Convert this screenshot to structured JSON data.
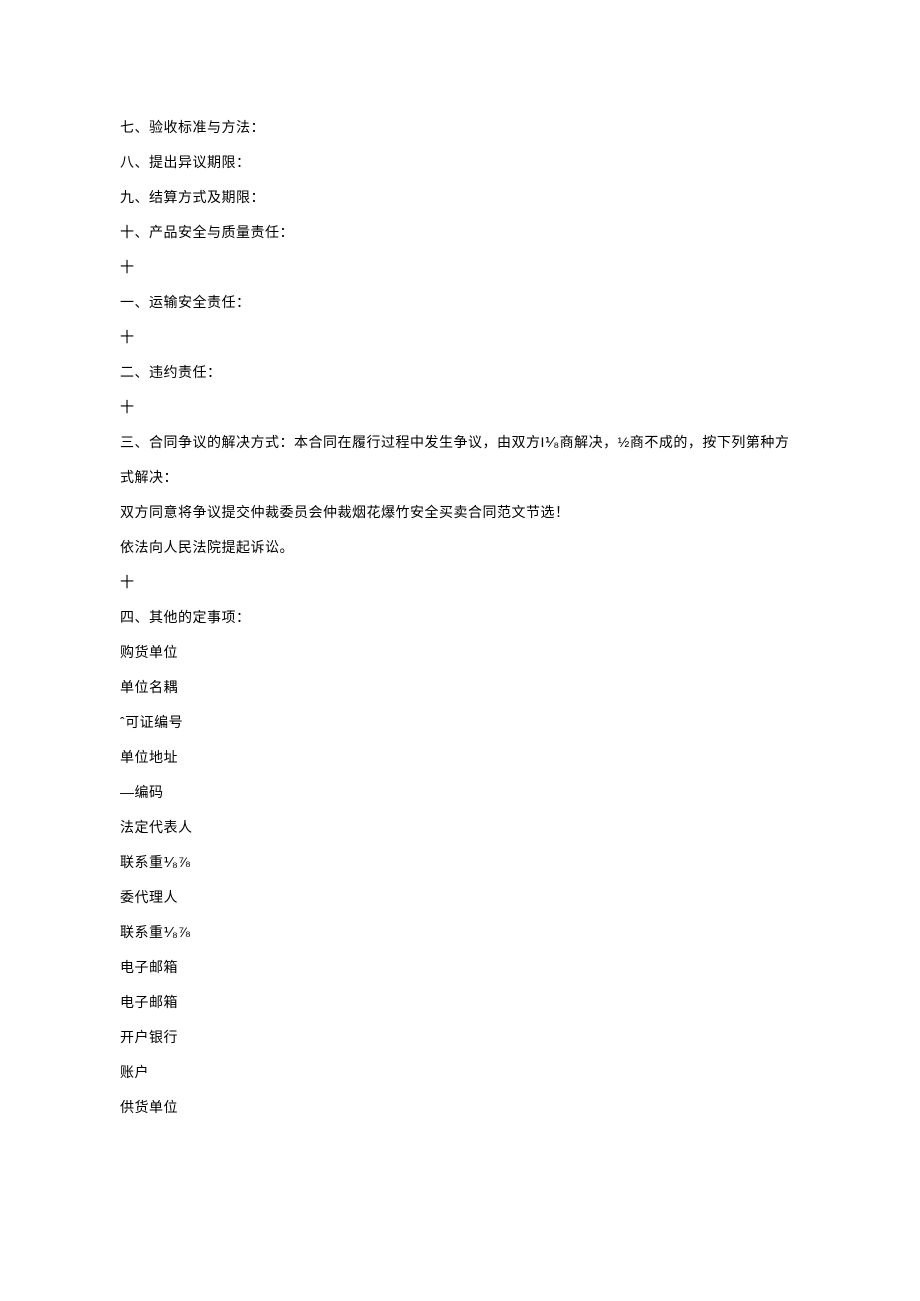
{
  "lines": [
    "七、验收标准与方法：",
    "八、提出异议期限：",
    "九、结算方式及期限：",
    "十、产品安全与质量责任：",
    "十",
    "一、运输安全责任：",
    "十",
    "二、违约责任：",
    "十",
    "三、合同争议的解决方式：本合同在履行过程中发生争议，由双方I⅟₈商解决，½商不成的，按下列第种方式解决：",
    "双方同意将争议提交仲裁委员会仲裁烟花爆竹安全买卖合同范文节选！",
    "依法向人民法院提起诉讼。",
    "十",
    "四、其他的定事项：",
    "购货单位",
    "单位名耦",
    "ˆ可证编号",
    "单位地址",
    "—编码",
    "法定代表人",
    "联系重⅟₈⅞",
    "委代理人",
    "联系重⅟₈⅞",
    "电子邮箱",
    "电子邮箱",
    "开户银行",
    "账户",
    "供货单位"
  ]
}
